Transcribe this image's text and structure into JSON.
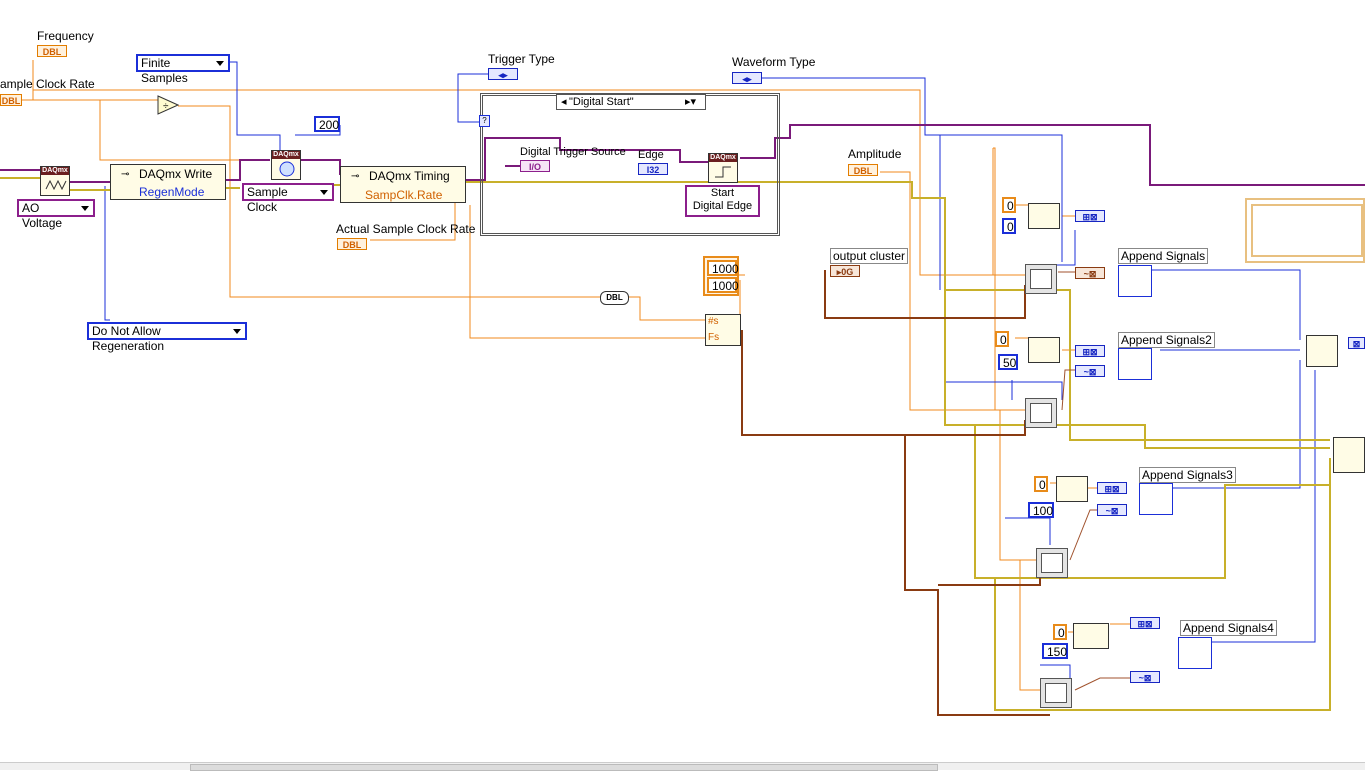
{
  "labels": {
    "frequency": "Frequency",
    "sample_clock_rate": "ample Clock Rate",
    "trigger_type": "Trigger Type",
    "waveform_type": "Waveform Type",
    "digital_trigger_source": "Digital Trigger Source",
    "edge": "Edge",
    "amplitude": "Amplitude",
    "actual_sample_clock_rate": "Actual Sample Clock Rate",
    "output_cluster": "output cluster",
    "append_signals": "Append Signals",
    "append_signals2": "Append Signals2",
    "append_signals3": "Append Signals3",
    "append_signals4": "Append Signals4"
  },
  "terminals": {
    "dbl": "DBL",
    "i32": "I32",
    "io": "I/O",
    "output_cluster_tag": "▸0G"
  },
  "rings": {
    "finite_samples": "Finite Samples",
    "ao_voltage": "AO Voltage",
    "sample_clock": "Sample Clock",
    "regen": "Do Not Allow Regeneration",
    "start_digital_edge_line1": "Start",
    "start_digital_edge_line2": "Digital Edge"
  },
  "case_selector": "\"Digital Start\"",
  "nodes": {
    "daqmx": "DAQmx",
    "daqmx_write": "DAQmx Write",
    "regen_mode": "RegenMode",
    "daqmx_timing": "DAQmx Timing",
    "sampclk_rate": "SampClk.Rate",
    "fs": "Fs",
    "hash_s": "#s"
  },
  "constants": {
    "c200": "200",
    "c1000a": "1000",
    "c1000b": "1000",
    "g1_offset": "0",
    "g1_phase": "0",
    "g2_offset": "0",
    "g2_phase": "50",
    "g3_offset": "0",
    "g3_phase": "100",
    "g4_offset": "0",
    "g4_phase": "150"
  },
  "colors": {
    "dbl_wire": "#f08a1c",
    "int_wire": "#1b2fd8",
    "task_wire": "#7a1a7a",
    "error_wire": "#d8c24a",
    "cluster_wire": "#8a3b12",
    "waveform_wire": "#a0522d"
  }
}
